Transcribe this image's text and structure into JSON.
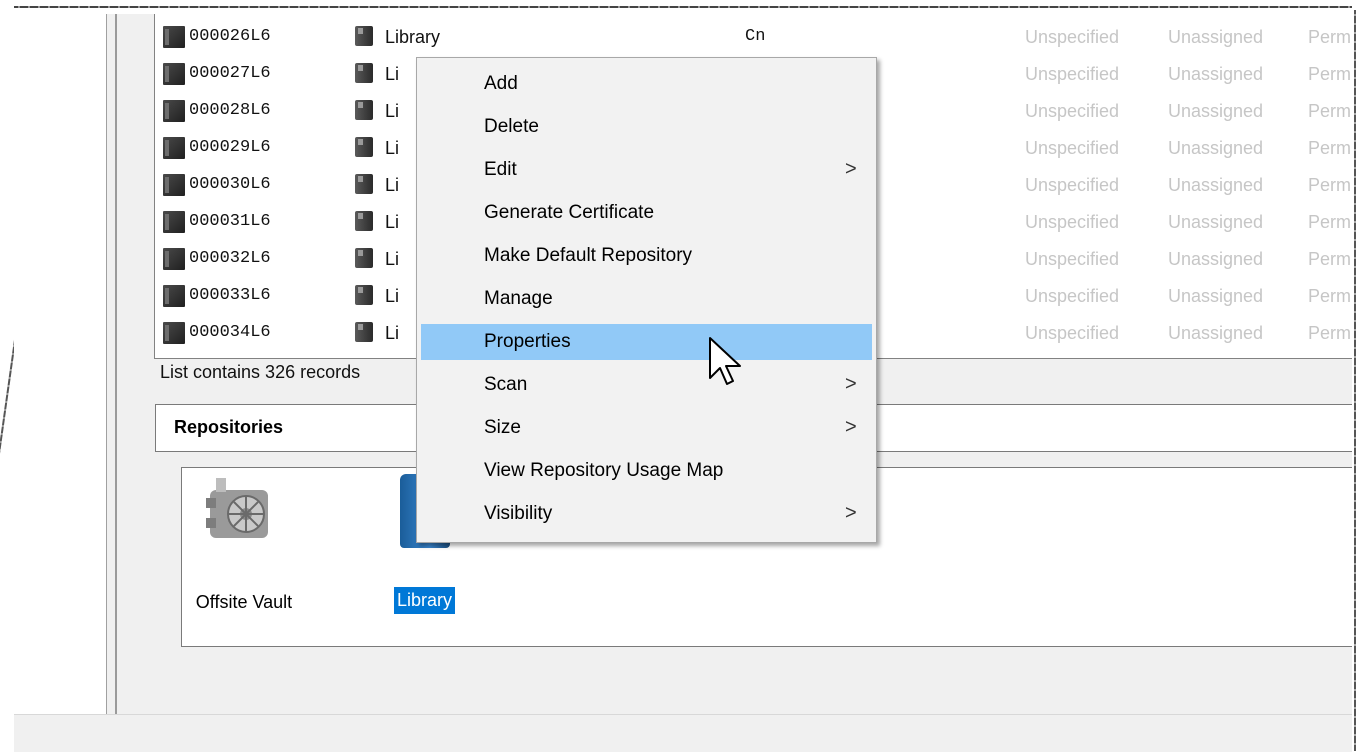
{
  "records": [
    {
      "id": "000026L6",
      "repository": "Library",
      "col3": "Cn",
      "col4": "Unspecified",
      "col5": "Unassigned",
      "col6": "Perm"
    },
    {
      "id": "000027L6",
      "repository": "Li",
      "col3": "",
      "col4": "Unspecified",
      "col5": "Unassigned",
      "col6": "Perm"
    },
    {
      "id": "000028L6",
      "repository": "Li",
      "col3": "",
      "col4": "Unspecified",
      "col5": "Unassigned",
      "col6": "Perm"
    },
    {
      "id": "000029L6",
      "repository": "Li",
      "col3": "",
      "col4": "Unspecified",
      "col5": "Unassigned",
      "col6": "Perm"
    },
    {
      "id": "000030L6",
      "repository": "Li",
      "col3": "",
      "col4": "Unspecified",
      "col5": "Unassigned",
      "col6": "Perm"
    },
    {
      "id": "000031L6",
      "repository": "Li",
      "col3": "",
      "col4": "Unspecified",
      "col5": "Unassigned",
      "col6": "Perm"
    },
    {
      "id": "000032L6",
      "repository": "Li",
      "col3": "",
      "col4": "Unspecified",
      "col5": "Unassigned",
      "col6": "Perm"
    },
    {
      "id": "000033L6",
      "repository": "Li",
      "col3": "",
      "col4": "Unspecified",
      "col5": "Unassigned",
      "col6": "Perm"
    },
    {
      "id": "000034L6",
      "repository": "Li",
      "col3": "",
      "col4": "Unspecified",
      "col5": "Unassigned",
      "col6": "Perm"
    }
  ],
  "status": "List contains 326 records",
  "repositories": {
    "header": "Repositories",
    "items": [
      {
        "label": "Offsite Vault",
        "icon": "vault-icon",
        "selected": false
      },
      {
        "label": "Library",
        "icon": "library-icon",
        "selected": true
      }
    ]
  },
  "context_menu": {
    "items": [
      {
        "label": "Add",
        "submenu": false
      },
      {
        "label": "Delete",
        "submenu": false
      },
      {
        "label": "Edit",
        "submenu": true
      },
      {
        "label": "Generate Certificate",
        "submenu": false
      },
      {
        "label": "Make Default Repository",
        "submenu": false
      },
      {
        "label": "Manage",
        "submenu": false
      },
      {
        "label": "Properties",
        "submenu": false,
        "highlighted": true
      },
      {
        "label": "Scan",
        "submenu": true
      },
      {
        "label": "Size",
        "submenu": true
      },
      {
        "label": "View Repository Usage Map",
        "submenu": false
      },
      {
        "label": "Visibility",
        "submenu": true
      }
    ],
    "submenu_arrow": ">"
  },
  "colors": {
    "highlight": "#91c9f7",
    "selection": "#0078d7",
    "muted_text": "#c6c6c6"
  }
}
